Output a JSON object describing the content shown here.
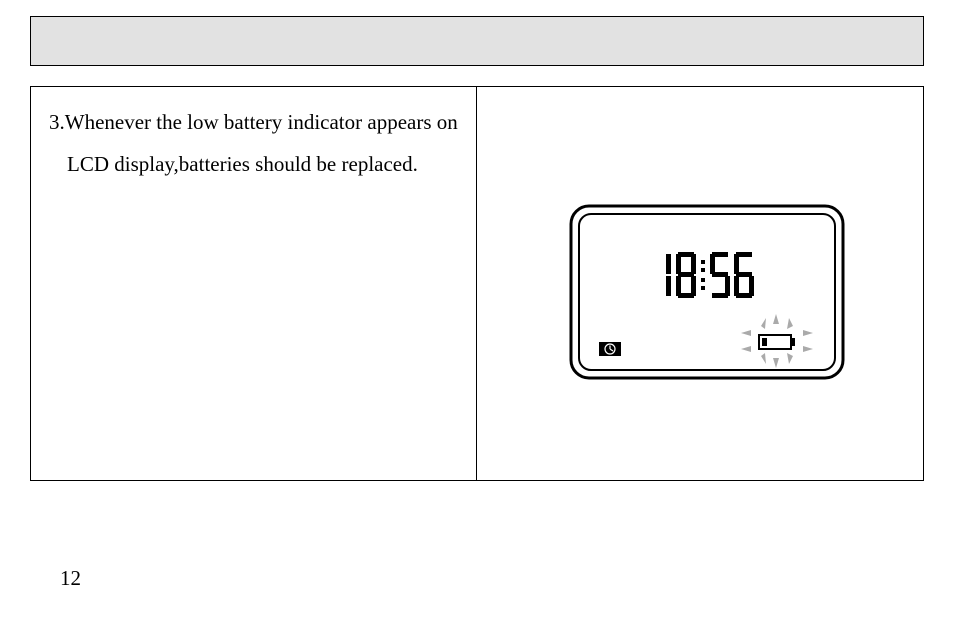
{
  "instruction": {
    "step_number": "3.",
    "line1": "Whenever the low battery indicator appears on",
    "line2": "LCD display,batteries should be replaced."
  },
  "lcd": {
    "time_display": "18:56",
    "battery_low_icon": "battery-low",
    "clock_icon": "clock"
  },
  "page_number": "12"
}
